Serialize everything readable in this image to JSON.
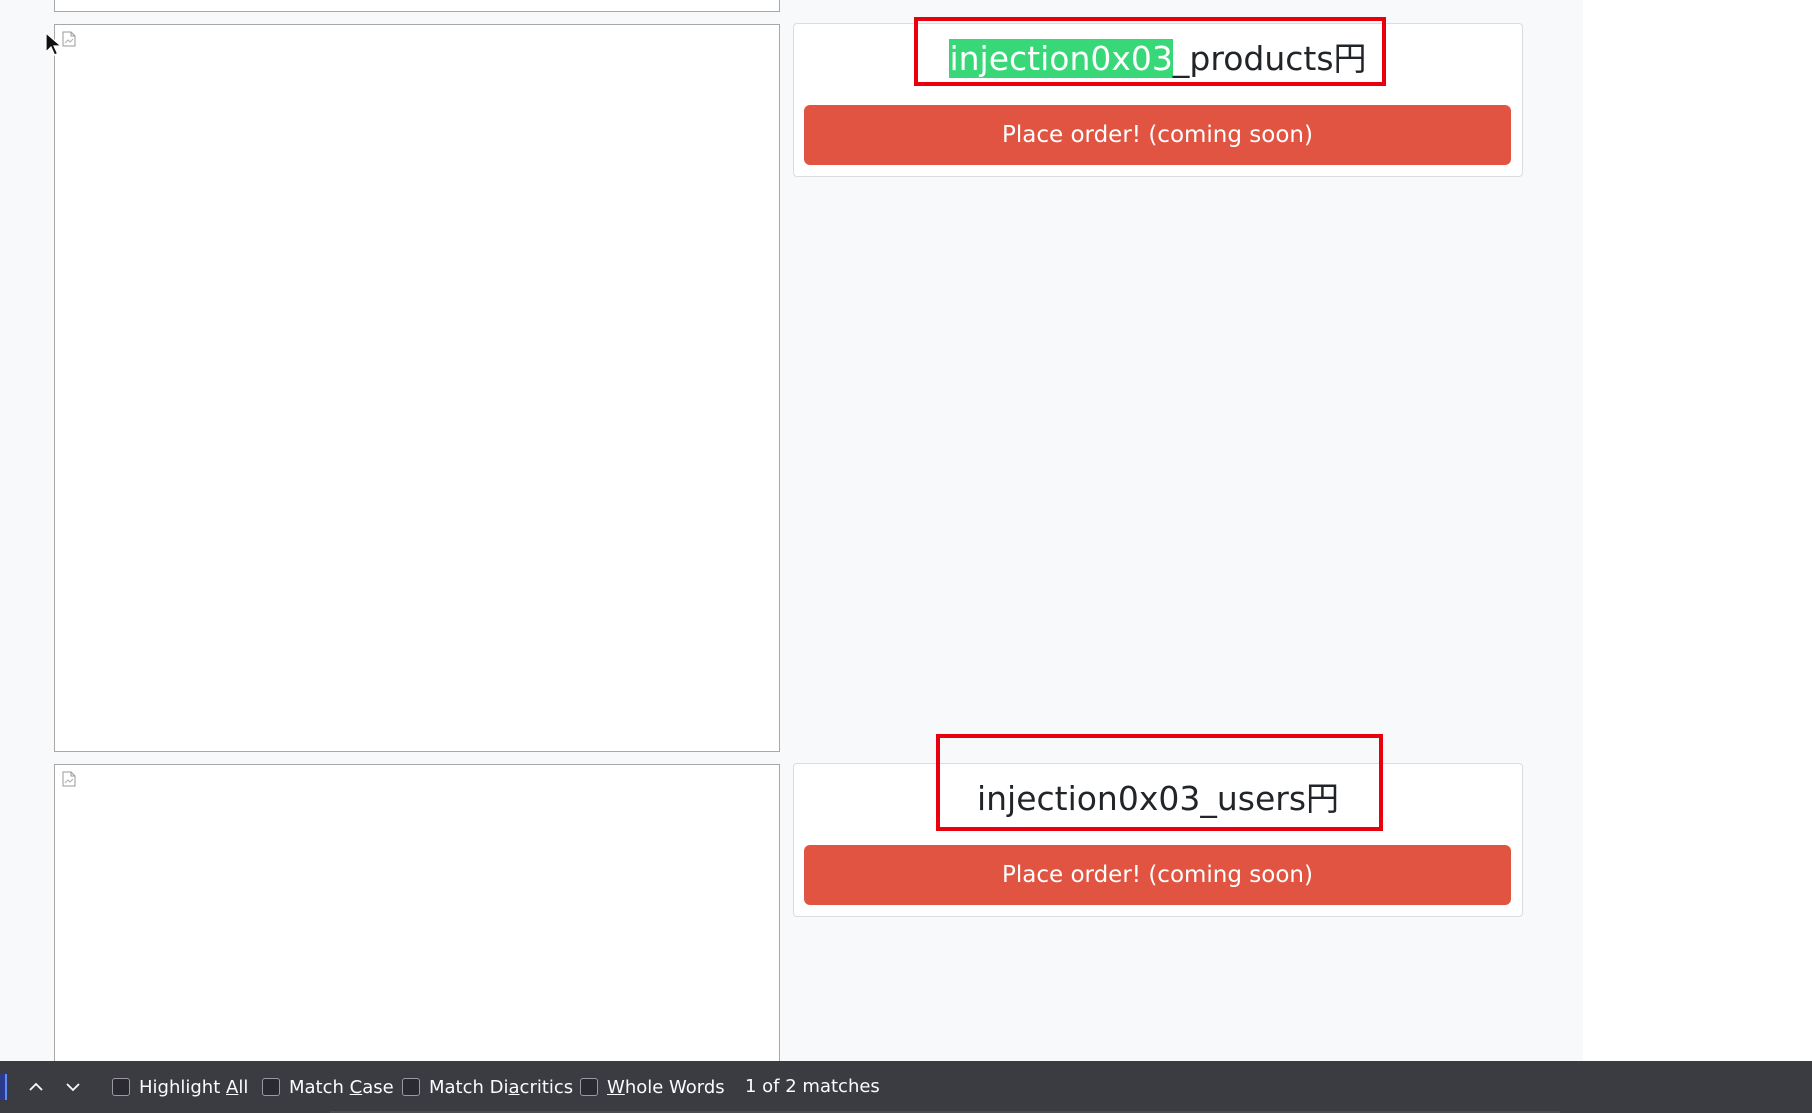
{
  "products": [
    {
      "title_match": "injection0x03",
      "title_rest": "_products円",
      "button_label": "Place order! (coming soon)"
    },
    {
      "title_match": "",
      "title_rest": "injection0x03_users円",
      "button_label": "Place order! (coming soon)"
    }
  ],
  "findbar": {
    "highlight_all": {
      "pre": "Highlight ",
      "key": "A",
      "post": "ll",
      "checked": false
    },
    "match_case": {
      "pre": "Match ",
      "key": "C",
      "post": "ase",
      "checked": false
    },
    "match_diacritics": {
      "pre": "Match Di",
      "key": "a",
      "post": "critics",
      "checked": false
    },
    "whole_words": {
      "pre": "",
      "key": "W",
      "post": "hole Words",
      "checked": false
    },
    "match_count": "1 of 2 matches"
  },
  "colors": {
    "page_background": "#f8f9fa",
    "button": "#e15441",
    "match_highlight": "#38d878",
    "annotation": "#e8000d",
    "findbar": "#3a3c42"
  },
  "icons": {
    "broken_image": "broken-image-icon",
    "find_previous": "chevron-up-icon",
    "find_next": "chevron-down-icon",
    "mouse_cursor": "mouse-cursor-icon"
  }
}
